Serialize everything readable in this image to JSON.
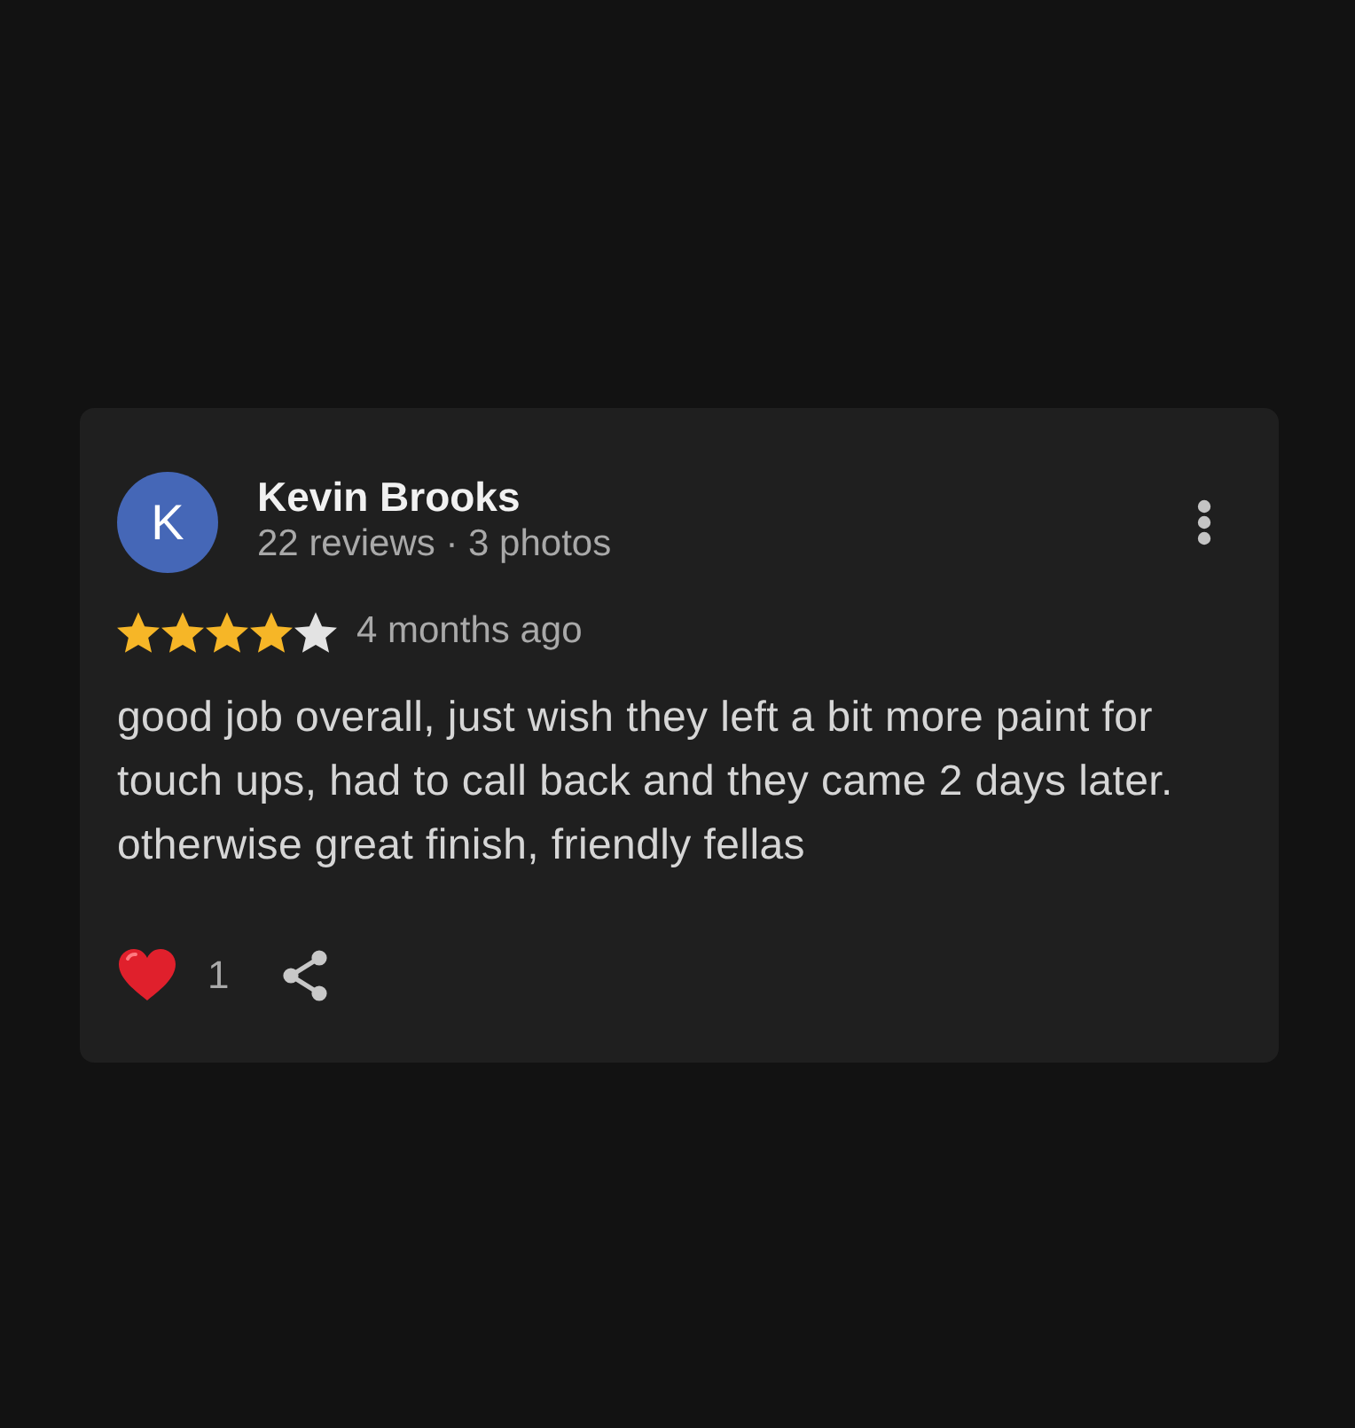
{
  "review": {
    "author": {
      "initial": "K",
      "name": "Kevin Brooks",
      "meta": "22 reviews · 3 photos"
    },
    "stars": 4,
    "time": "4 months ago",
    "text": "good job overall, just wish they left a bit more paint for touch ups, had to call back and they came 2 days later. otherwise great finish, friendly fellas",
    "likes": "1"
  }
}
